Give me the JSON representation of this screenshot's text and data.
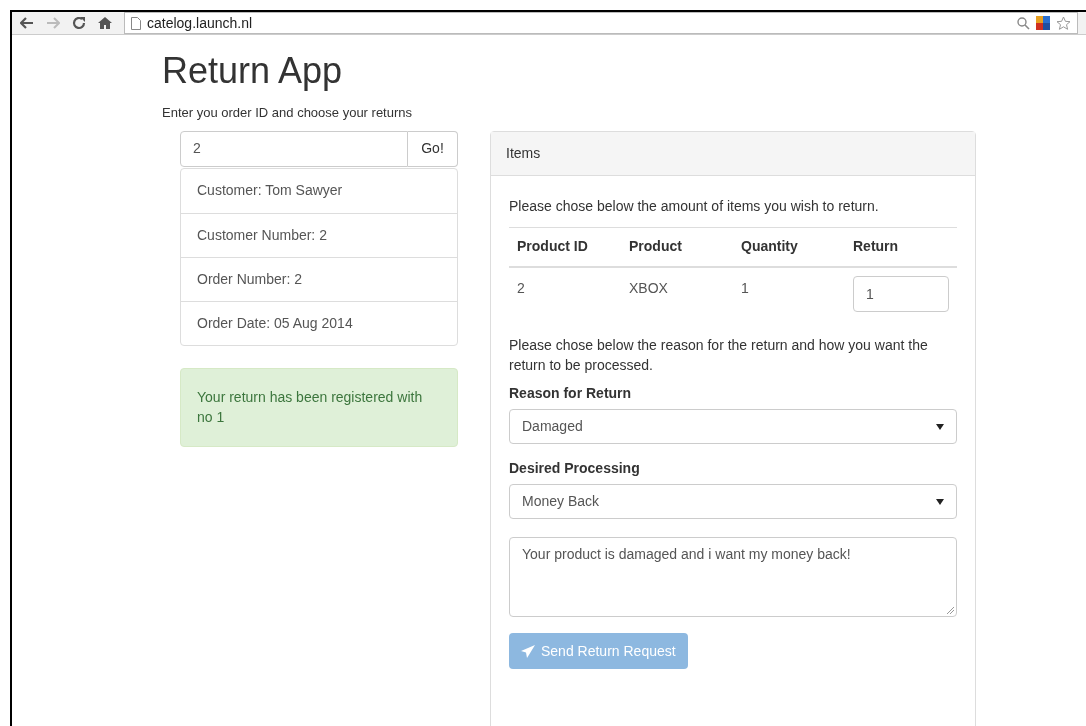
{
  "browser": {
    "url": "catelog.launch.nl"
  },
  "page": {
    "title": "Return App",
    "subtitle": "Enter you order ID and choose your returns"
  },
  "order_search": {
    "value": "2",
    "button": "Go!"
  },
  "order_details": [
    "Customer: Tom Sawyer",
    "Customer Number: 2",
    "Order Number: 2",
    "Order Date: 05 Aug 2014"
  ],
  "alert": {
    "text": "Your return has been registered with no 1"
  },
  "items_panel": {
    "heading": "Items",
    "intro": "Please chose below the amount of items you wish to return.",
    "table": {
      "columns": [
        "Product ID",
        "Product",
        "Quantity",
        "Return"
      ],
      "rows": [
        {
          "product_id": "2",
          "product": "XBOX",
          "quantity": "1",
          "return": "1"
        }
      ]
    },
    "reason_intro": "Please chose below the reason for the return and how you want the return to be processed.",
    "reason": {
      "label": "Reason for Return",
      "value": "Damaged"
    },
    "processing": {
      "label": "Desired Processing",
      "value": "Money Back"
    },
    "comment": {
      "value": "Your product is damaged and i want my money back!"
    },
    "submit": {
      "label": "Send Return Request",
      "disabled": true
    }
  }
}
